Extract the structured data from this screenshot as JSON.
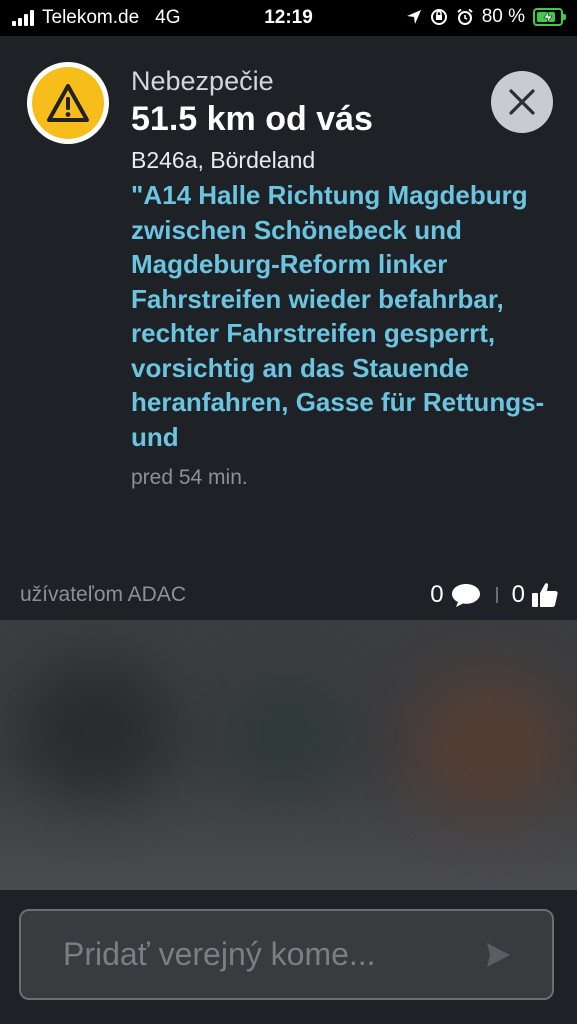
{
  "status_bar": {
    "carrier": "Telekom.de",
    "network": "4G",
    "time": "12:19",
    "battery_percent": "80 %",
    "battery_level": 0.8
  },
  "alert": {
    "category": "Nebezpečie",
    "distance": "51.5 km od vás",
    "location": "B246a, Bördeland",
    "description": "\"A14 Halle Richtung Magdeburg zwischen Schönebeck und Magdeburg-Reform linker Fahrstreifen wieder befahrbar, rechter Fahrstreifen gesperrt, vorsichtig an das Stauende heranfahren, Gasse für Rettungs- und",
    "time_ago": "pred 54 min.",
    "reporter": "užívateľom ADAC",
    "comment_count": "0",
    "like_count": "0",
    "icon": "warning-icon",
    "accent_color": "#f7bd1a",
    "description_color": "#6cc5e0"
  },
  "comment": {
    "placeholder": "Pridať verejný kome..."
  }
}
